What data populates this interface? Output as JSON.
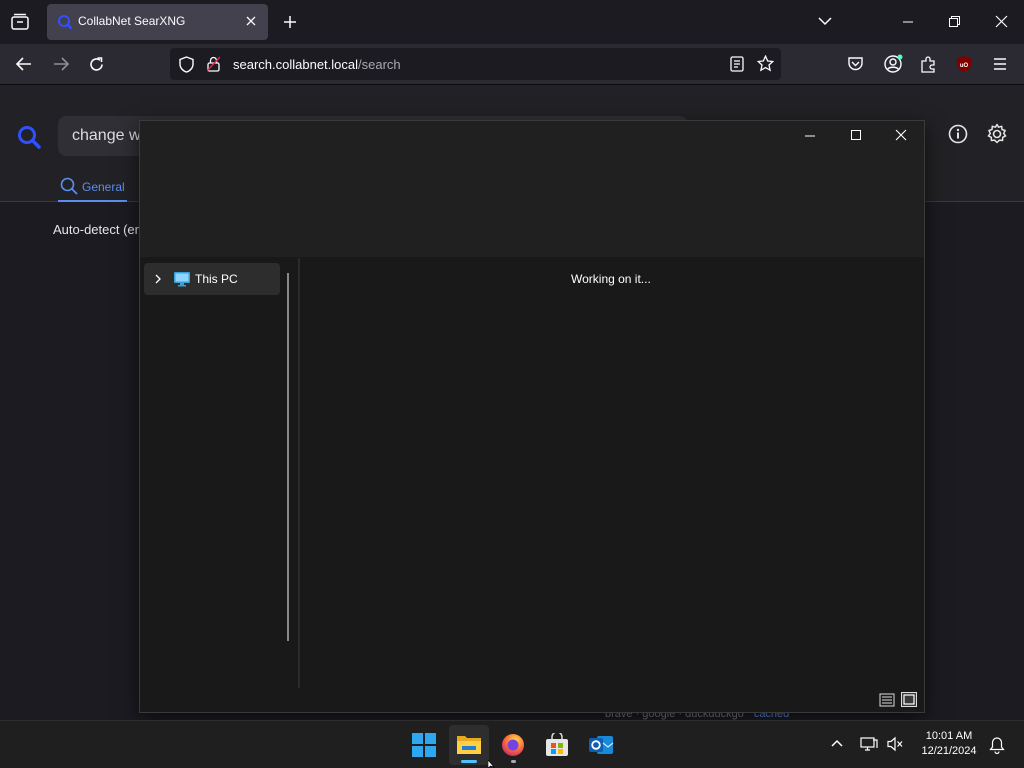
{
  "browser": {
    "tab_title": "CollabNet SearXNG",
    "url_host": "search.collabnet.local",
    "url_path": "/search",
    "theme_accent": "#5b8dee"
  },
  "searxng": {
    "query_visible": "change w",
    "category_tab": "General",
    "language_label": "Auto-detect (er",
    "footer_engines": "brave · google · duckduckgo",
    "footer_cached": "cached"
  },
  "explorer": {
    "nav_tree": [
      {
        "label": "This PC",
        "icon": "computer-icon",
        "expandable": true
      }
    ],
    "status_message": "Working on it...",
    "view_modes": [
      "details-view-icon",
      "large-icons-view-icon"
    ]
  },
  "taskbar": {
    "apps": [
      {
        "name": "start",
        "icon": "windows-start-icon"
      },
      {
        "name": "file-explorer",
        "icon": "folder-icon",
        "active": true
      },
      {
        "name": "firefox",
        "icon": "firefox-icon",
        "running": true
      },
      {
        "name": "microsoft-store",
        "icon": "store-icon"
      },
      {
        "name": "outlook",
        "icon": "outlook-icon"
      }
    ],
    "time": "10:01 AM",
    "date": "12/21/2024"
  }
}
